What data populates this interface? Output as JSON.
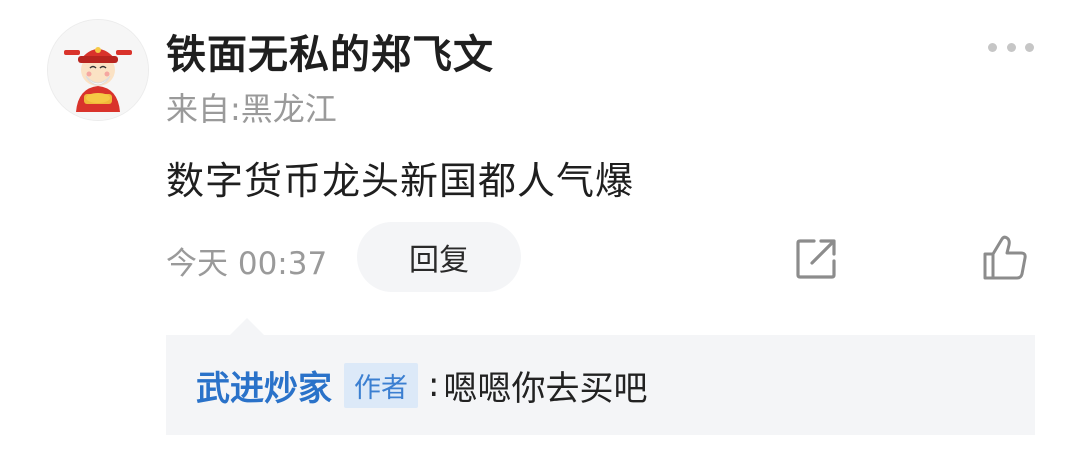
{
  "post": {
    "username": "铁面无私的郑飞文",
    "location": "来自:黑龙江",
    "content": "数字货币龙头新国都人气爆",
    "time": "今天 00:37",
    "reply_label": "回复"
  },
  "icons": {
    "avatar": "cartoon-god-of-wealth-avatar",
    "more": "more-dots-icon",
    "share": "share-icon",
    "like": "thumbs-up-icon"
  },
  "reply": {
    "author": "武进炒家",
    "badge": "作者",
    "separator": ":",
    "text": "嗯嗯你去买吧"
  },
  "colors": {
    "link_blue": "#2a72c9",
    "badge_bg": "#dce9f8",
    "reply_bg": "#f4f5f7",
    "muted": "#9a9a9a"
  }
}
